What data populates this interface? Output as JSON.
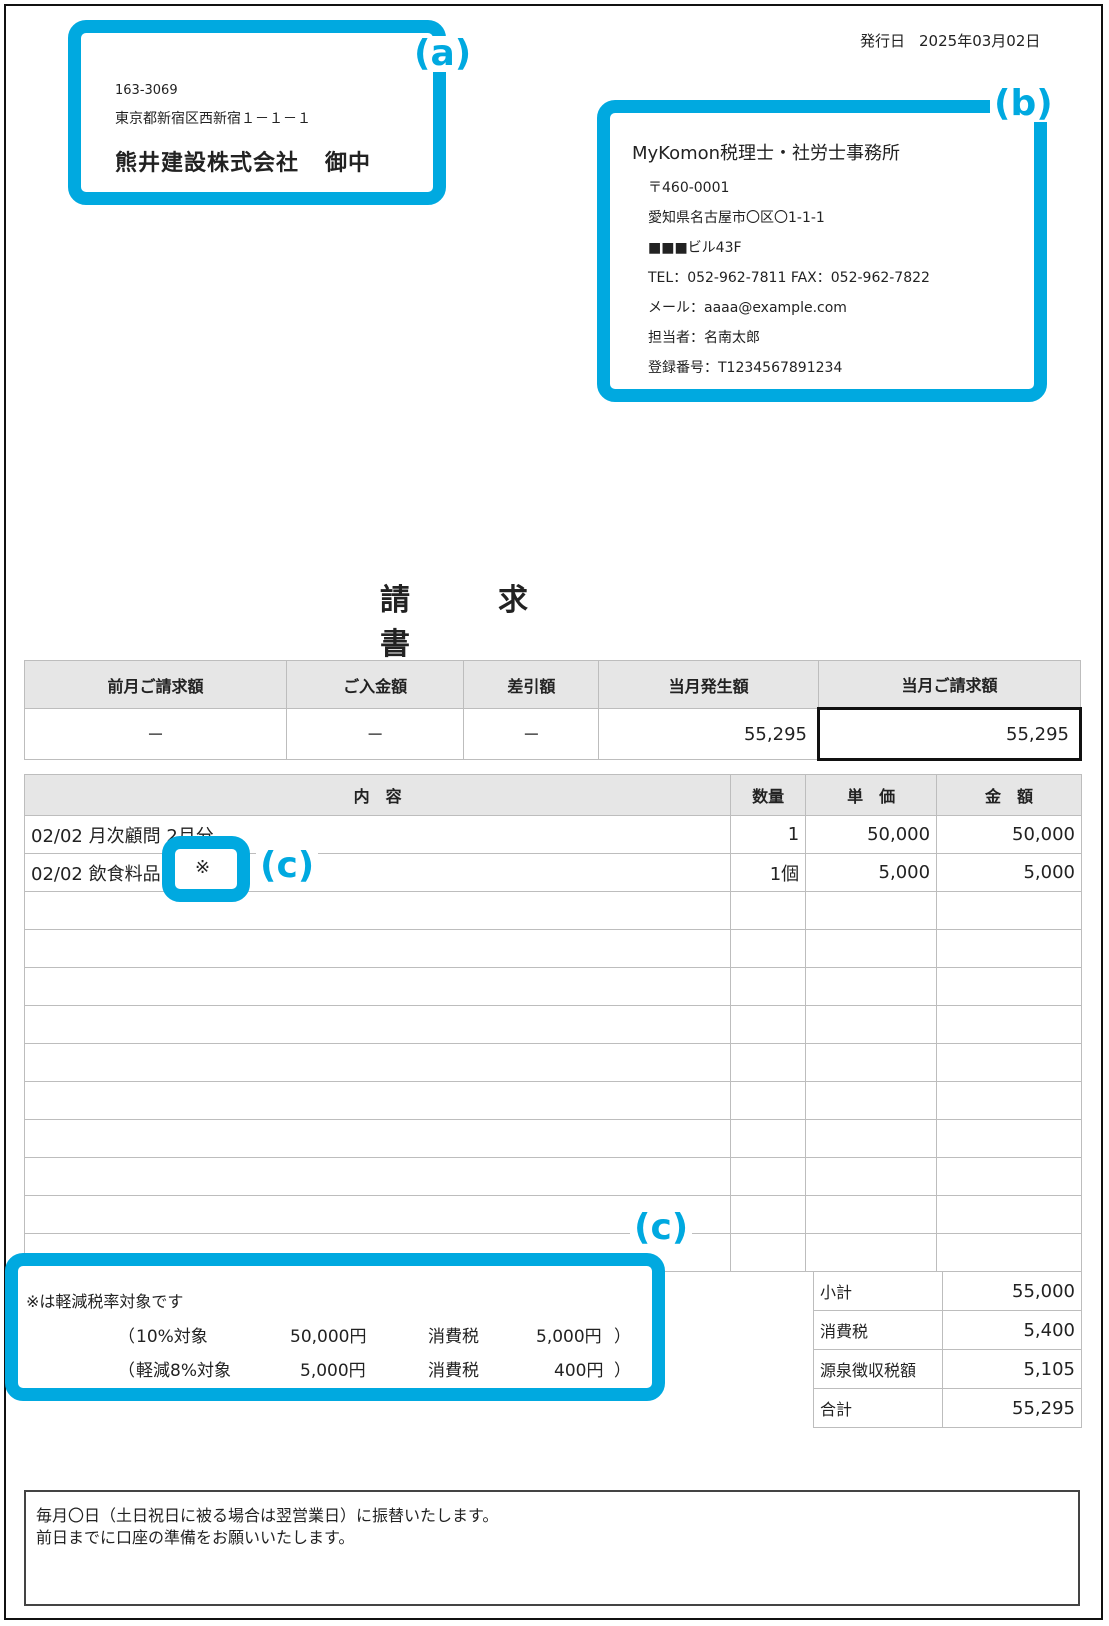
{
  "issue": {
    "label": "発行日",
    "date": "2025年03月02日"
  },
  "recipient": {
    "callout_label": "(a)",
    "zip": "163-3069",
    "address": "東京都新宿区西新宿１－１－１",
    "company": "熊井建設株式会社",
    "honorific": "御中"
  },
  "sender": {
    "callout_label": "(b)",
    "name": "MyKomon税理士・社労士事務所",
    "zip": "〒460-0001",
    "address1": "愛知県名古屋市〇区〇1-1-1",
    "address2": "■■■ビル43F",
    "phone": "TEL：052-962-7811 FAX：052-962-7822",
    "email": "メール：aaaa@example.com",
    "contact": "担当者：名南太郎",
    "registration": "登録番号：T1234567891234"
  },
  "title": [
    "請",
    "求",
    "書"
  ],
  "summary": {
    "headers": [
      "前月ご請求額",
      "ご入金額",
      "差引額",
      "当月発生額",
      "当月ご請求額"
    ],
    "values": [
      "－",
      "－",
      "－",
      "55,295",
      "55,295"
    ]
  },
  "items": {
    "headers": [
      "内　容",
      "数量",
      "単　価",
      "金　額"
    ],
    "rows": [
      {
        "desc": "02/02 月次顧問 2月分",
        "qty": "1",
        "price": "50,000",
        "amount": "50,000"
      },
      {
        "desc": "02/02 飲食料品",
        "qty": "1個",
        "price": "5,000",
        "amount": "5,000"
      }
    ]
  },
  "reduced_mark": {
    "symbol": "※",
    "callout_label": "(c)"
  },
  "tax_note": {
    "callout_label": "(c)",
    "note": "※は軽減税率対象です",
    "rows": [
      {
        "open": "（",
        "label": "10%対象",
        "base": "50,000円",
        "tax_label": "消費税",
        "tax": "5,000円",
        "close": "）"
      },
      {
        "open": "（",
        "label": "軽減8%対象",
        "base": "5,000円",
        "tax_label": "消費税",
        "tax": "400円",
        "close": "）"
      }
    ]
  },
  "totals": [
    {
      "label": "小計",
      "value": "55,000"
    },
    {
      "label": "消費税",
      "value": "5,400"
    },
    {
      "label": "源泉徴収税額",
      "value": "5,105"
    },
    {
      "label": "合計",
      "value": "55,295"
    }
  ],
  "remarks": [
    "毎月〇日（土日祝日に被る場合は翌営業日）に振替いたします。",
    "前日までに口座の準備をお願いいたします。"
  ],
  "colors": {
    "callout": "#00a9e0",
    "header_bg": "#e6e6e6"
  }
}
